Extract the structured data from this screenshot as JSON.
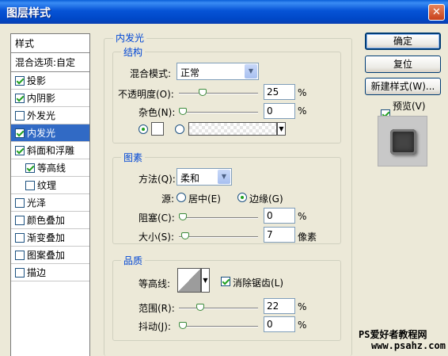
{
  "window": {
    "title": "图层样式"
  },
  "sidebar": {
    "header": "样式",
    "blend": "混合选项:自定",
    "items": [
      {
        "label": "投影",
        "checked": true
      },
      {
        "label": "内阴影",
        "checked": true
      },
      {
        "label": "外发光",
        "checked": false
      },
      {
        "label": "内发光",
        "checked": true,
        "selected": true
      },
      {
        "label": "斜面和浮雕",
        "checked": true
      },
      {
        "label": "等高线",
        "checked": true,
        "sub": true
      },
      {
        "label": "纹理",
        "checked": false,
        "sub": true
      },
      {
        "label": "光泽",
        "checked": false
      },
      {
        "label": "颜色叠加",
        "checked": false
      },
      {
        "label": "渐变叠加",
        "checked": false
      },
      {
        "label": "图案叠加",
        "checked": false
      },
      {
        "label": "描边",
        "checked": false
      }
    ]
  },
  "panel": {
    "title": "内发光"
  },
  "structure": {
    "legend": "结构",
    "blend_label": "混合模式:",
    "blend_value": "正常",
    "opacity_label": "不透明度(O):",
    "opacity_value": "25",
    "opacity_pct": 25,
    "noise_label": "杂色(N):",
    "noise_value": "0",
    "noise_pct": 0,
    "unit": "%"
  },
  "elements": {
    "legend": "图素",
    "method_label": "方法(Q):",
    "method_value": "柔和",
    "source_label": "源:",
    "center_label": "居中(E)",
    "edge_label": "边缘(G)",
    "choke_label": "阻塞(C):",
    "choke_value": "0",
    "choke_pct": 0,
    "size_label": "大小(S):",
    "size_value": "7",
    "size_unit": "像素",
    "unit": "%"
  },
  "quality": {
    "legend": "品质",
    "contour_label": "等高线:",
    "antialias_label": "消除锯齿(L)",
    "range_label": "范围(R):",
    "range_value": "22",
    "range_pct": 22,
    "jitter_label": "抖动(J):",
    "jitter_value": "0",
    "jitter_pct": 0,
    "unit": "%"
  },
  "buttons": {
    "ok": "确定",
    "reset": "复位",
    "new_style": "新建样式(W)...",
    "preview": "预览(V)"
  },
  "watermark": {
    "line1": "PS爱好者教程网",
    "line2": "www.psahz.com"
  },
  "colors": {
    "titlebar": "#0653d6",
    "selection": "#316ac5",
    "legend": "#0046d5",
    "face": "#ece9d8"
  }
}
